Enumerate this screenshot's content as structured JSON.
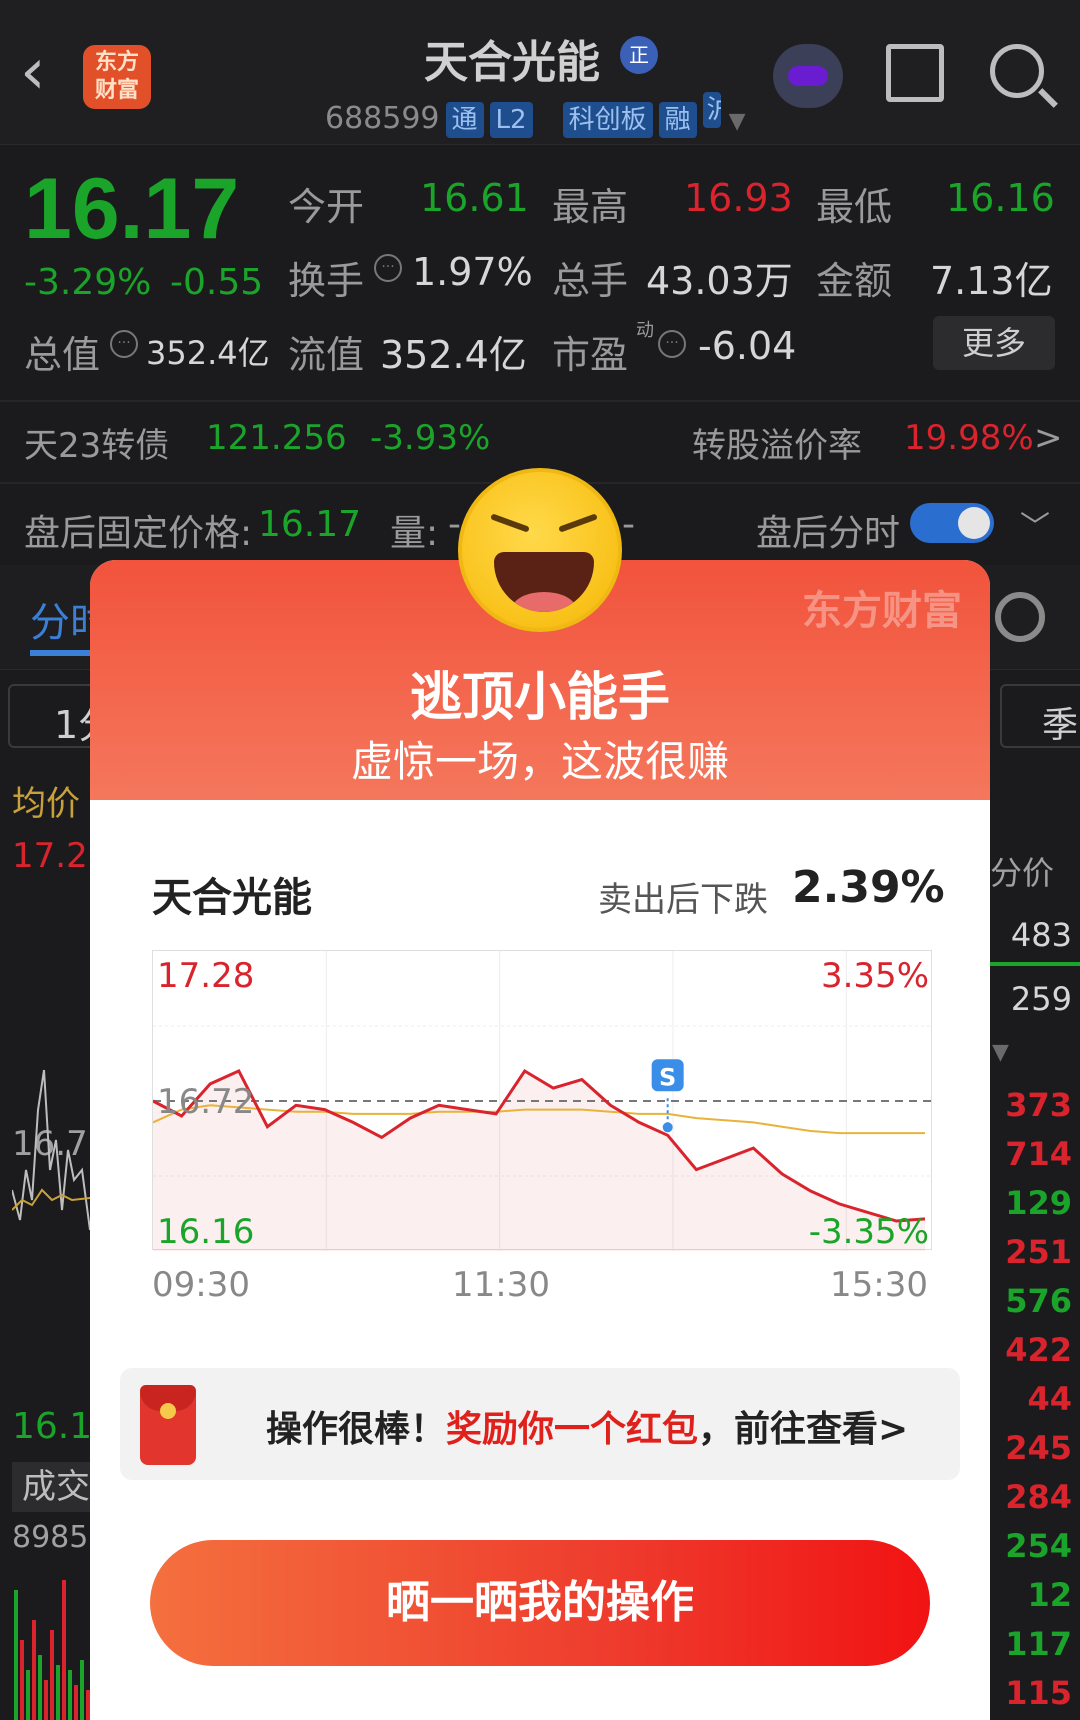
{
  "header": {
    "back_icon": "chevron-left-icon",
    "logo_text": "东方\n财富",
    "stock_name": "天合光能",
    "zheng_badge": "正",
    "code": "688599",
    "tags": [
      "通",
      "L2",
      "科创板",
      "融",
      "沪"
    ]
  },
  "quote": {
    "price": "16.17",
    "change_pct": "-3.29%",
    "change_val": "-0.55",
    "open_label": "今开",
    "open": "16.61",
    "high_label": "最高",
    "high": "16.93",
    "low_label": "最低",
    "low": "16.16",
    "turnover_label": "换手",
    "turnover": "1.97%",
    "volume_label": "总手",
    "volume": "43.03万",
    "amount_label": "金额",
    "amount": "7.13亿",
    "mktcap_label": "总值",
    "mktcap": "352.4亿",
    "float_label": "流值",
    "float": "352.4亿",
    "pe_label": "市盈",
    "pe_sup": "动",
    "pe": "-6.04",
    "more_label": "更多"
  },
  "bond": {
    "name": "天23转债",
    "price": "121.256",
    "pct": "-3.93%",
    "premium_label": "转股溢价率",
    "premium": "19.98%",
    "arrow": ">"
  },
  "after_hours": {
    "fixed_label": "盘后固定价格:",
    "fixed_price": "16.17",
    "vol_label": "量:",
    "vol_value": "-",
    "dash": "-",
    "toggle_label": "盘后分时"
  },
  "background": {
    "tab_label": "分时",
    "btn_1": "1分",
    "btn_season": "季",
    "avg_label": "均价",
    "price_top": "17.2",
    "price_mid": "16.7",
    "price_low": "16.1",
    "vol_label": "成交",
    "vol_num": "8985",
    "fenjia": "分价",
    "right_top": [
      {
        "v": "483",
        "c": "#d6d6d6"
      },
      {
        "v": "259",
        "c": "#d6d6d6"
      }
    ],
    "right_list": [
      {
        "v": "373",
        "c": "#d9232d"
      },
      {
        "v": "714",
        "c": "#d9232d"
      },
      {
        "v": "129",
        "c": "#1aa52a"
      },
      {
        "v": "251",
        "c": "#d9232d"
      },
      {
        "v": "576",
        "c": "#1aa52a"
      },
      {
        "v": "422",
        "c": "#d9232d"
      },
      {
        "v": "44",
        "c": "#d9232d"
      },
      {
        "v": "245",
        "c": "#d9232d"
      },
      {
        "v": "284",
        "c": "#d9232d"
      },
      {
        "v": "254",
        "c": "#1aa52a"
      },
      {
        "v": "12",
        "c": "#1aa52a"
      },
      {
        "v": "117",
        "c": "#1aa52a"
      },
      {
        "v": "115",
        "c": "#d9232d"
      }
    ]
  },
  "modal": {
    "brand": "东方财富",
    "title": "逃顶小能手",
    "subtitle": "虚惊一场，这波很赚",
    "card_name": "天合光能",
    "drop_label": "卖出后下跌",
    "drop_value": "2.39%",
    "chart_high": "17.28",
    "chart_high_pct": "3.35%",
    "chart_mid": "16.72",
    "chart_low": "16.16",
    "chart_low_pct": "-3.35%",
    "sell_marker": "S",
    "time_start": "09:30",
    "time_mid": "11:30",
    "time_end": "15:30",
    "redpack_text_1": "操作很棒！",
    "redpack_text_2": "奖励你一个红包",
    "redpack_text_3": "，前往查看>",
    "share_button": "晒一晒我的操作"
  },
  "colors": {
    "up": "#d9232d",
    "down": "#1aa52a",
    "accent": "#3b7fd6",
    "modal_red": "#f2533c"
  },
  "chart_data": {
    "type": "line",
    "x": [
      "09:30",
      "11:30",
      "15:30"
    ],
    "ylim": [
      16.16,
      17.28
    ],
    "baseline": 16.72,
    "series": [
      {
        "values": [
          16.72,
          16.65,
          16.8,
          16.86,
          16.6,
          16.7,
          16.68,
          16.62,
          16.55,
          16.64,
          16.7,
          16.68,
          16.66,
          16.86,
          16.78,
          16.82,
          16.7,
          16.62,
          16.56,
          16.4,
          16.45,
          16.5,
          16.38,
          16.3,
          16.24,
          16.2,
          16.16,
          16.17
        ]
      },
      {
        "values": [
          16.62,
          16.68,
          16.7,
          16.69,
          16.68,
          16.67,
          16.67,
          16.66,
          16.66,
          16.66,
          16.67,
          16.67,
          16.67,
          16.68,
          16.68,
          16.68,
          16.67,
          16.66,
          16.66,
          16.64,
          16.63,
          16.62,
          16.6,
          16.58,
          16.57,
          16.57,
          16.57,
          16.57
        ]
      }
    ]
  }
}
